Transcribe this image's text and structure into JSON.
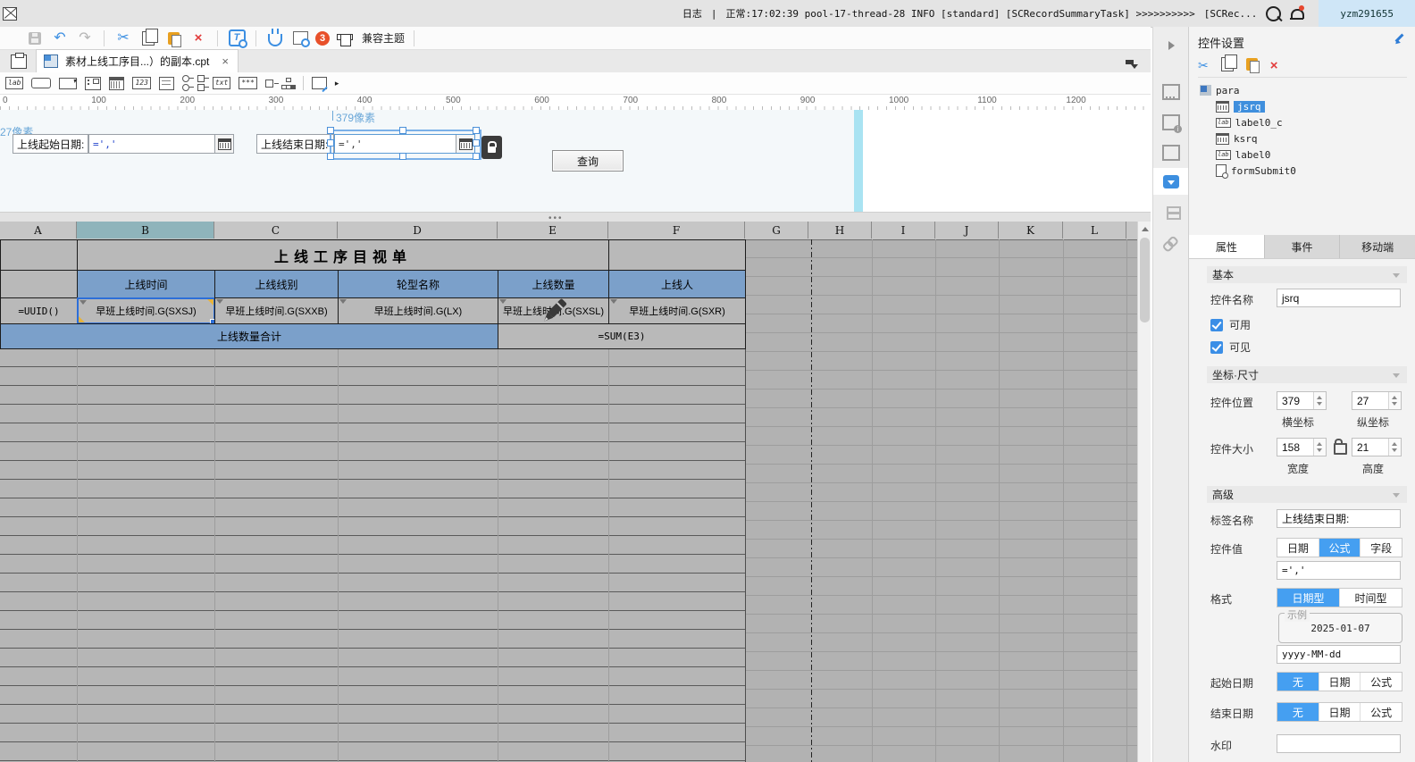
{
  "topbar": {
    "log_label": "日志",
    "separator": "|",
    "log_text": "正常:17:02:39 pool-17-thread-28 INFO [standard] [SCRecordSummaryTask] >>>>>>>>>>",
    "log_truncated": "[SCRec...",
    "username": "yzm291655"
  },
  "toolbar": {
    "compat_theme_label": "兼容主题",
    "notification_badge": "3",
    "delete_glyph": "×",
    "cut_glyph": "✂",
    "undo_glyph": "↶",
    "redo_glyph": "↷",
    "tsearch_glyph": "T"
  },
  "tabrow": {
    "doc_title": "素材上线工序目...）的副本.cpt",
    "close_glyph": "×"
  },
  "widgetbar": {
    "lab": "lab",
    "number": "123",
    "text": "txt",
    "password": "***",
    "arrow": "▸"
  },
  "ruler": {
    "marks": [
      "0",
      "100",
      "200",
      "300",
      "400",
      "500",
      "600",
      "700",
      "800",
      "900",
      "1000",
      "1100",
      "1200"
    ]
  },
  "form": {
    "width_hint": "379像素",
    "height_hint": "27像素",
    "start_label": "上线起始日期:",
    "start_value": "=','",
    "end_label": "上线结束日期:",
    "end_value": "=','",
    "query_label": "查询",
    "splitter_dots": "•••"
  },
  "sheet": {
    "columns": [
      "A",
      "B",
      "C",
      "D",
      "E",
      "F",
      "G",
      "H",
      "I",
      "J",
      "K",
      "L"
    ],
    "title": "上线工序目视单",
    "headers": [
      "上线时间",
      "上线线别",
      "轮型名称",
      "上线数量",
      "上线人"
    ],
    "uuid_formula": "=UUID()",
    "cells": [
      "早班上线时间.G(SXSJ)",
      "早班上线时间.G(SXXB)",
      "早班上线时间.G(LX)",
      "早班上线时间.G(SXSL)",
      "早班上线时间.G(SXR)"
    ],
    "sum_label": "上线数量合计",
    "sum_formula": "=SUM(E3)"
  },
  "panel": {
    "title": "控件设置",
    "cut_glyph": "✂",
    "delete_glyph": "×",
    "tree": {
      "root": "para",
      "item1": "jsrq",
      "item2": "label0_c",
      "item3": "ksrq",
      "item4": "label0",
      "item5": "formSubmit0"
    },
    "tabs": {
      "t1": "属性",
      "t2": "事件",
      "t3": "移动端"
    },
    "basic_section": "基本",
    "name_label": "控件名称",
    "name_value": "jsrq",
    "enabled_label": "可用",
    "visible_label": "可见",
    "coord_section": "坐标·尺寸",
    "position_label": "控件位置",
    "pos_x": "379",
    "pos_y": "27",
    "x_axis_label": "横坐标",
    "y_axis_label": "纵坐标",
    "size_label": "控件大小",
    "width_value": "158",
    "height_value": "21",
    "width_label": "宽度",
    "height_label": "高度",
    "advanced_section": "高级",
    "tag_label": "标签名称",
    "tag_value": "上线结束日期:",
    "value_label": "控件值",
    "value_tab_date": "日期",
    "value_tab_formula": "公式",
    "value_tab_field": "字段",
    "value_formula": "=','",
    "format_label": "格式",
    "format_tab_date": "日期型",
    "format_tab_time": "时间型",
    "sample_legend": "示例",
    "sample_value": "2025-01-07",
    "format_pattern": "yyyy-MM-dd",
    "startdate_label": "起始日期",
    "enddate_label": "结束日期",
    "opt_none": "无",
    "opt_date": "日期",
    "opt_formula": "公式",
    "watermark_label": "水印"
  }
}
